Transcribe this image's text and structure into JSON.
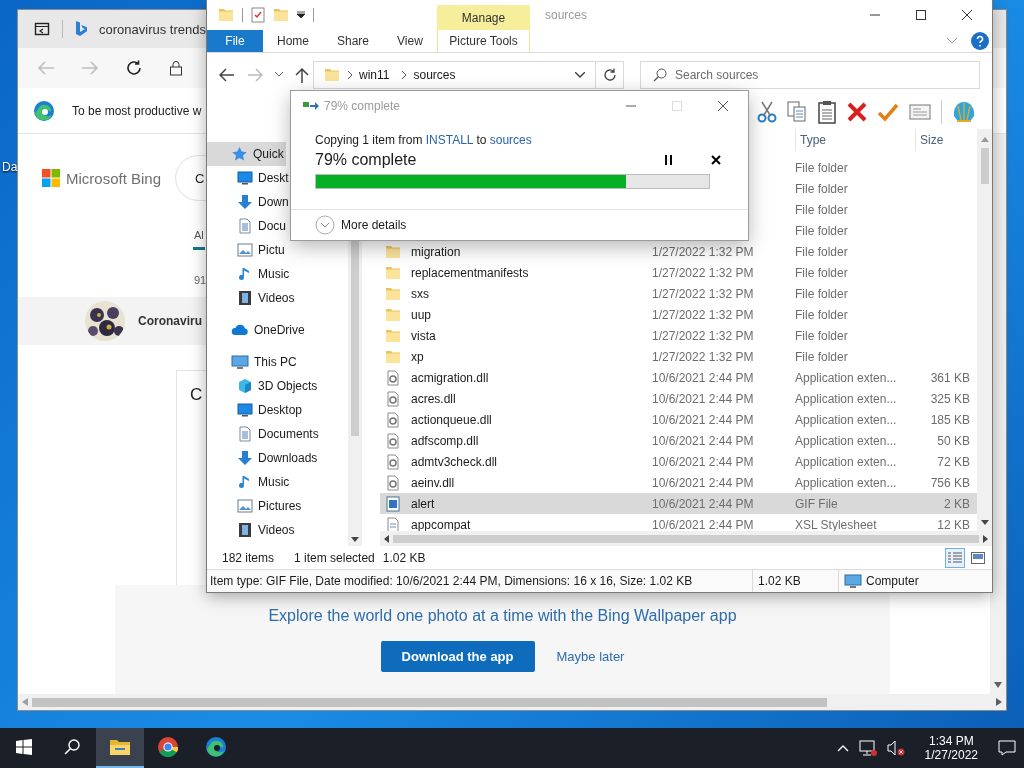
{
  "desktop": {
    "icon_label": "Da"
  },
  "browser": {
    "tab_title": "coronavirus trends",
    "infobar": "To be most productive w",
    "logo": "Microsoft Bing",
    "search_text": "C",
    "nav_tab": {
      "label": "Al",
      "selected": true
    },
    "result_count": "91",
    "topic": "Coronaviru",
    "card_title": "C",
    "banner": {
      "text": "Explore the world one photo at a time with the Bing Wallpaper app",
      "primary_button": "Download the app",
      "link": "Maybe later"
    }
  },
  "explorer": {
    "title": "sources",
    "context_header": "Manage",
    "ribbon_tabs": [
      {
        "label": "File",
        "kind": "file"
      },
      {
        "label": "Home",
        "kind": "tab"
      },
      {
        "label": "Share",
        "kind": "tab"
      },
      {
        "label": "View",
        "kind": "tab"
      },
      {
        "label": "Picture Tools",
        "kind": "context"
      }
    ],
    "path": [
      "win11",
      "sources"
    ],
    "search": {
      "placeholder": "Search sources"
    },
    "nav": [
      {
        "label": "Quick",
        "kind": "star",
        "selected": true,
        "children": [
          {
            "label": "Deskt",
            "kind": "desktop",
            "selected": false
          },
          {
            "label": "Down",
            "kind": "download",
            "selected": false
          },
          {
            "label": "Docu",
            "kind": "document",
            "selected": false
          },
          {
            "label": "Pictu",
            "kind": "picture",
            "selected": false
          },
          {
            "label": "Music",
            "kind": "music",
            "selected": false
          },
          {
            "label": "Videos",
            "kind": "video",
            "selected": false
          }
        ]
      },
      {
        "label": "OneDrive",
        "kind": "cloud",
        "selected": false
      },
      {
        "label": "This PC",
        "kind": "pc",
        "selected": false,
        "children": [
          {
            "label": "3D Objects",
            "kind": "cube",
            "selected": false
          },
          {
            "label": "Desktop",
            "kind": "desktop",
            "selected": false
          },
          {
            "label": "Documents",
            "kind": "document",
            "selected": false
          },
          {
            "label": "Downloads",
            "kind": "download",
            "selected": false
          },
          {
            "label": "Music",
            "kind": "music",
            "selected": false
          },
          {
            "label": "Pictures",
            "kind": "picture",
            "selected": false
          },
          {
            "label": "Videos",
            "kind": "video",
            "selected": false
          }
        ]
      }
    ],
    "columns": [
      "Type",
      "Size"
    ],
    "rows": [
      {
        "type": "File folder",
        "selected": false
      },
      {
        "type": "File folder",
        "selected": false
      },
      {
        "type": "File folder",
        "selected": false
      },
      {
        "type": "File folder",
        "selected": false
      },
      {
        "name": "migration",
        "date": "1/27/2022 1:32 PM",
        "type": "File folder",
        "kind": "folder",
        "selected": false
      },
      {
        "name": "replacementmanifests",
        "date": "1/27/2022 1:32 PM",
        "type": "File folder",
        "kind": "folder",
        "selected": false
      },
      {
        "name": "sxs",
        "date": "1/27/2022 1:32 PM",
        "type": "File folder",
        "kind": "folder",
        "selected": false
      },
      {
        "name": "uup",
        "date": "1/27/2022 1:32 PM",
        "type": "File folder",
        "kind": "folder",
        "selected": false
      },
      {
        "name": "vista",
        "date": "1/27/2022 1:32 PM",
        "type": "File folder",
        "kind": "folder",
        "selected": false
      },
      {
        "name": "xp",
        "date": "1/27/2022 1:32 PM",
        "type": "File folder",
        "kind": "folder",
        "selected": false
      },
      {
        "name": "acmigration.dll",
        "date": "10/6/2021 2:44 PM",
        "type": "Application exten...",
        "size": "361 KB",
        "kind": "dll",
        "selected": false
      },
      {
        "name": "acres.dll",
        "date": "10/6/2021 2:44 PM",
        "type": "Application exten...",
        "size": "325 KB",
        "kind": "dll",
        "selected": false
      },
      {
        "name": "actionqueue.dll",
        "date": "10/6/2021 2:44 PM",
        "type": "Application exten...",
        "size": "185 KB",
        "kind": "dll",
        "selected": false
      },
      {
        "name": "adfscomp.dll",
        "date": "10/6/2021 2:44 PM",
        "type": "Application exten...",
        "size": "50 KB",
        "kind": "dll",
        "selected": false
      },
      {
        "name": "admtv3check.dll",
        "date": "10/6/2021 2:44 PM",
        "type": "Application exten...",
        "size": "72 KB",
        "kind": "dll",
        "selected": false
      },
      {
        "name": "aeinv.dll",
        "date": "10/6/2021 2:44 PM",
        "type": "Application exten...",
        "size": "756 KB",
        "kind": "dll",
        "selected": false
      },
      {
        "name": "alert",
        "date": "10/6/2021 2:44 PM",
        "type": "GIF File",
        "size": "2 KB",
        "kind": "gif",
        "selected": true
      },
      {
        "name": "appcompat",
        "date": "10/6/2021 2:44 PM",
        "type": "XSL Stylesheet",
        "size": "12 KB",
        "kind": "xsl",
        "selected": false
      }
    ],
    "item_count": "182 items",
    "selection": "1 item selected",
    "selection_size": "1.02 KB",
    "status": {
      "details": "Item type: GIF File, Date modified: 10/6/2021 2:44 PM, Dimensions: 16 x 16, Size: 1.02 KB",
      "size": "1.02 KB",
      "zone": "Computer"
    }
  },
  "dialog": {
    "title": "79% complete",
    "message": [
      {
        "text": "Copying 1 item from ",
        "kind": "plain"
      },
      {
        "text": "INSTALL",
        "kind": "link"
      },
      {
        "text": " to ",
        "kind": "plain"
      },
      {
        "text": "sources",
        "kind": "link"
      }
    ],
    "heading": "79% complete",
    "level": 0.79,
    "more": "More details"
  },
  "taskbar": {
    "apps": [
      {
        "kind": "explorer",
        "selected": true
      },
      {
        "kind": "chrome",
        "selected": false
      },
      {
        "kind": "edge",
        "selected": false
      }
    ],
    "time": "1:34 PM",
    "date": "1/27/2022"
  }
}
